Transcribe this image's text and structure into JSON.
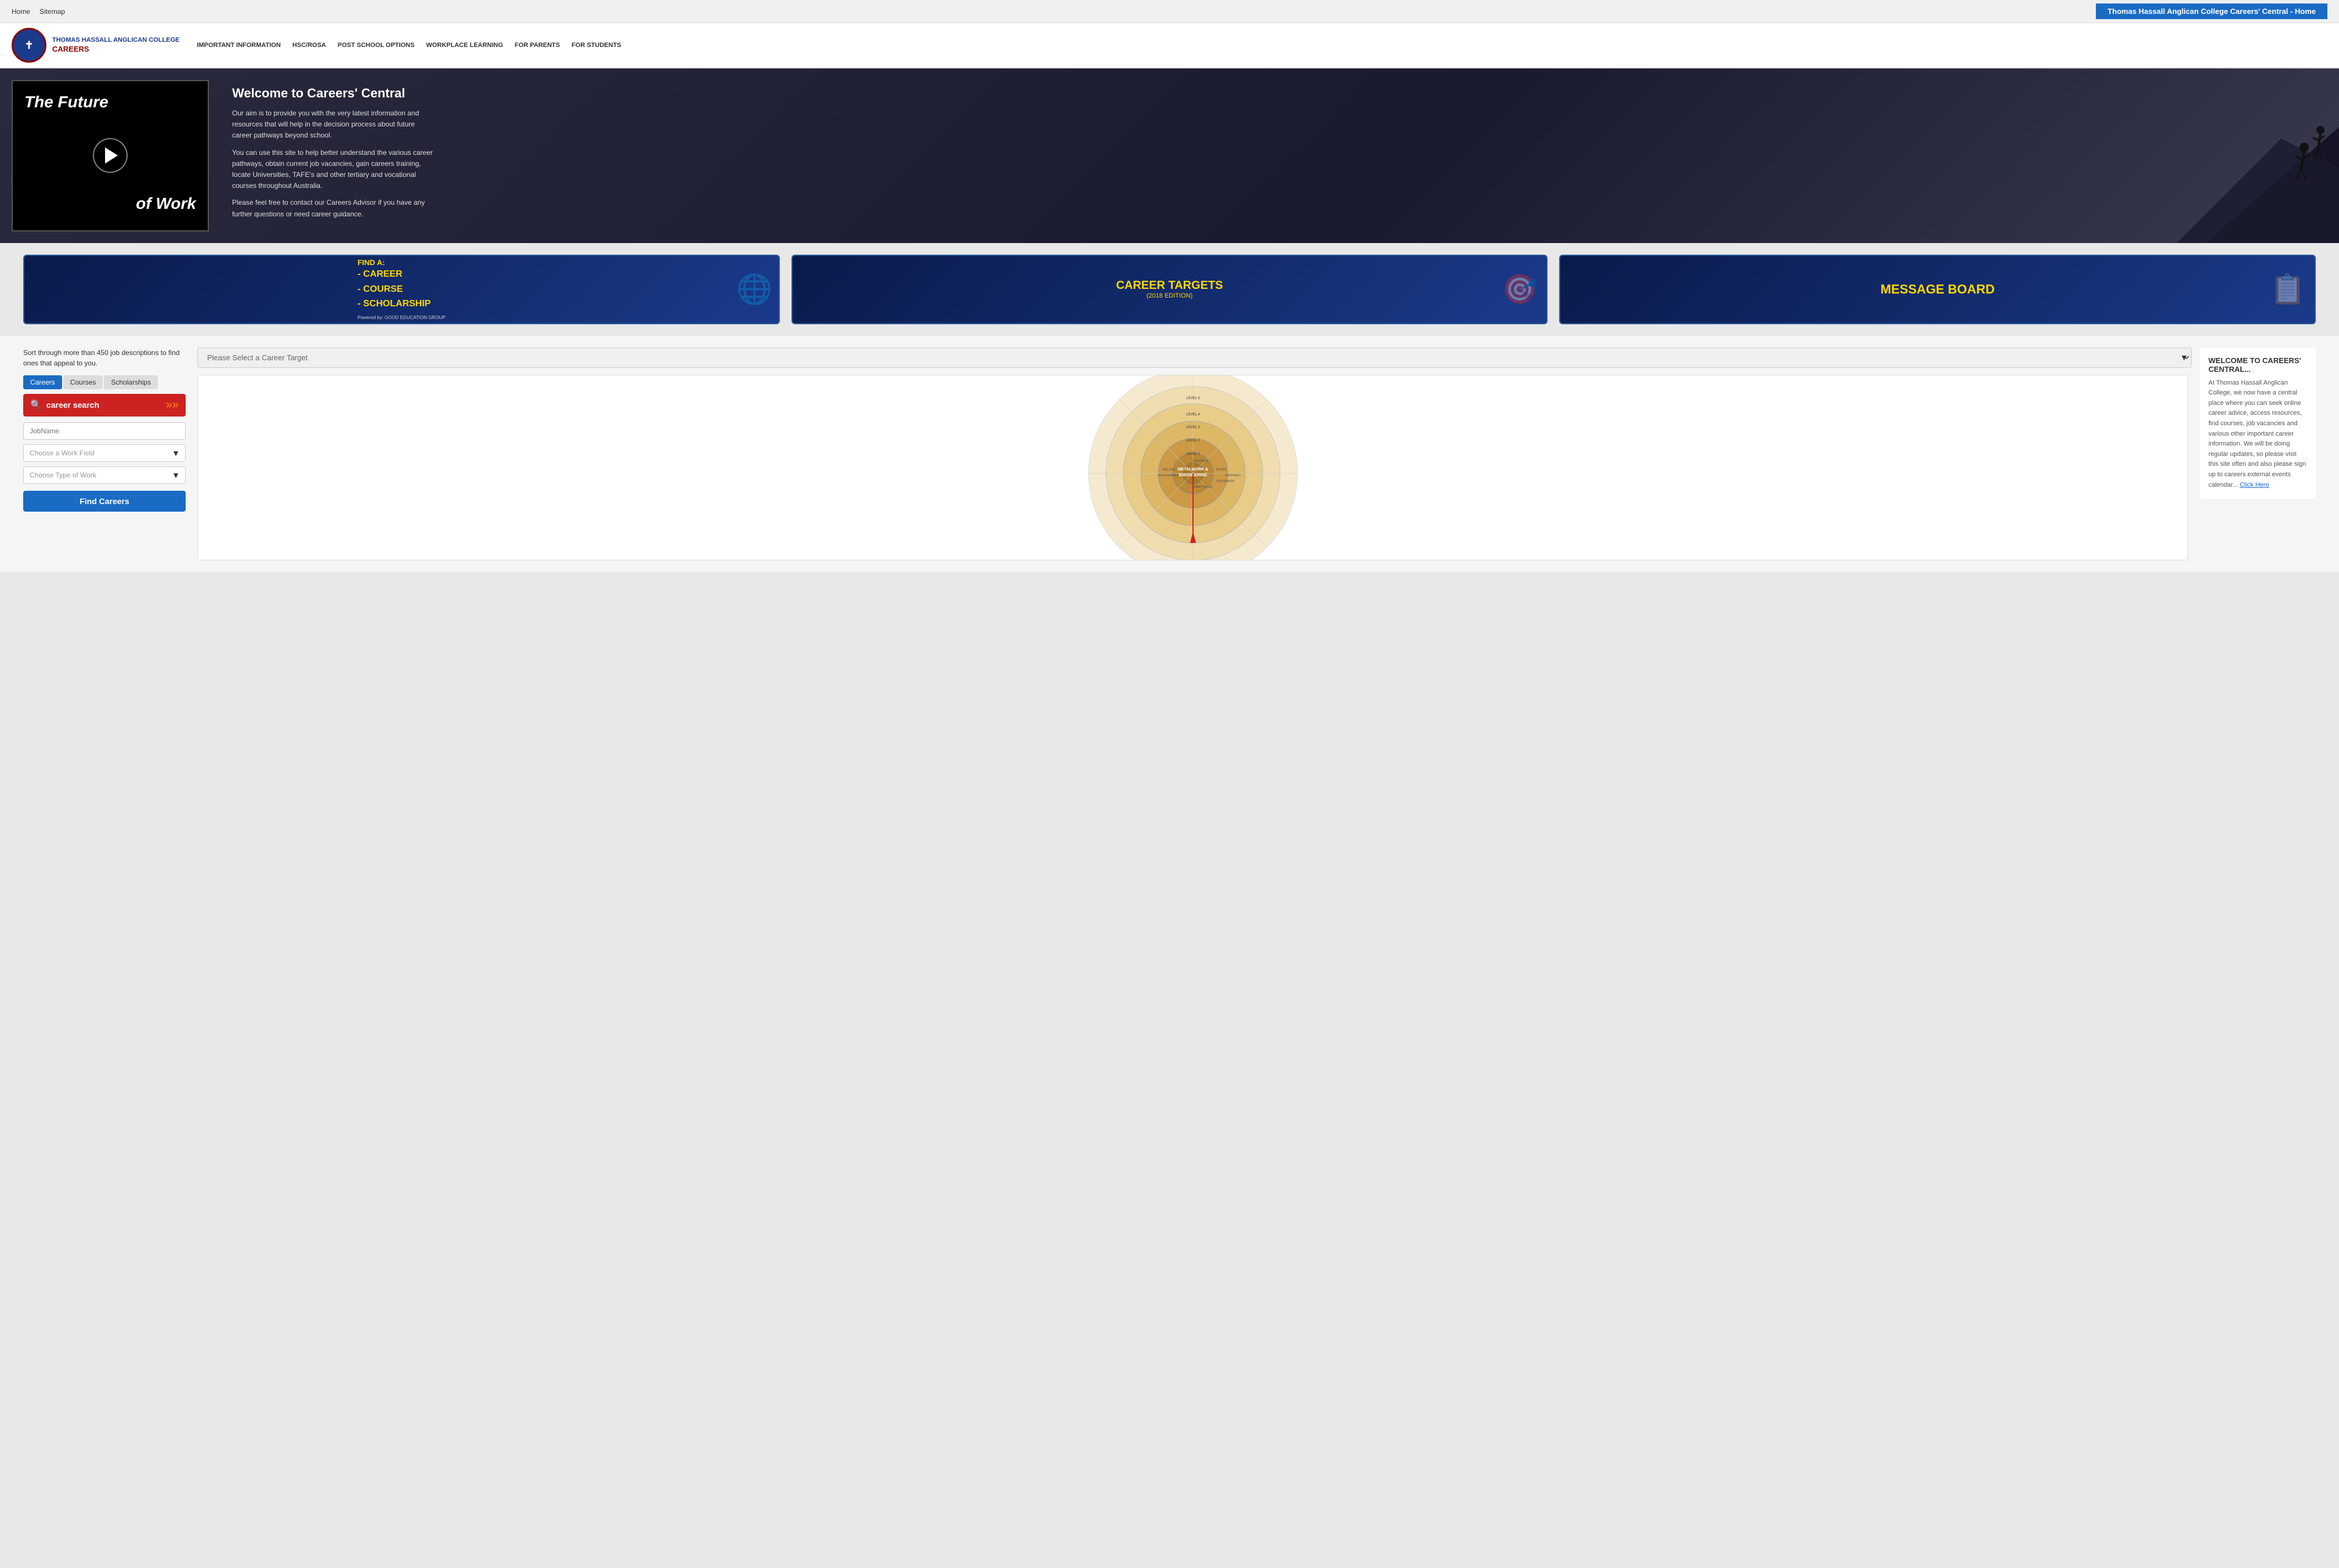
{
  "topbar": {
    "links": [
      "Home",
      "Sitemap"
    ],
    "title": "Thomas Hassall Anglican College Careers' Central - Home"
  },
  "header": {
    "school_name": "THOMAS HASSALL ANGLICAN COLLEGE",
    "careers_label": "CAREERS",
    "nav_items": [
      "IMPORTANT INFORMATION",
      "HSC/ROSA",
      "POST SCHOOL OPTIONS",
      "WORKPLACE LEARNING",
      "FOR PARENTS",
      "FOR STUDENTS"
    ]
  },
  "hero": {
    "video_text1": "The Future",
    "video_text2": "of Work",
    "welcome_title": "Welcome to Careers' Central",
    "para1": "Our aim is to provide you with the very latest information and resources that will help in the decision process about future career pathways beyond school.",
    "para2": "You can use this site to help better understand the various career pathways, obtain current job vacancies, gain careers training, locate Universities, TAFE's and other tertiary and vocational courses throughout Australia.",
    "para3": "Please feel free to contact our Careers Advisor if you have any further questions or need career guidance."
  },
  "feature_cards": [
    {
      "id": "find-a",
      "find_label": "FIND A:",
      "items": "- CAREER\n- COURSE\n- SCHOLARSHIP",
      "powered": "Powered by: GOOD EDUCATION GROUP"
    },
    {
      "id": "career-targets",
      "title": "CAREER TARGETS",
      "subtitle": "(2018 EDITION)"
    },
    {
      "id": "message-board",
      "title": "MESSAGE BOARD"
    }
  ],
  "search_section": {
    "sort_text": "Sort through more than 450 job descriptions to find ones that appeal to you.",
    "tabs": [
      "Careers",
      "Courses",
      "Scholarships"
    ],
    "active_tab": "Careers",
    "search_label": "career search",
    "jobname_placeholder": "JobName",
    "workfield_placeholder": "Choose a Work Field",
    "worktype_placeholder": "Choose Type of Work",
    "find_btn": "Find Careers"
  },
  "career_targets": {
    "select_placeholder": "Please Select a Career Target"
  },
  "welcome_right": {
    "title": "WELCOME TO CAREERS' CENTRAL...",
    "body": "At Thomas Hassall Anglican College, we now have a central place where you can seek online career advice, access resources, find courses, job vacancies and various other important career information. We will be doing regular updates, so please visit this site often and also please sign up to careers external events calendar...",
    "link_text": "Click Here"
  }
}
